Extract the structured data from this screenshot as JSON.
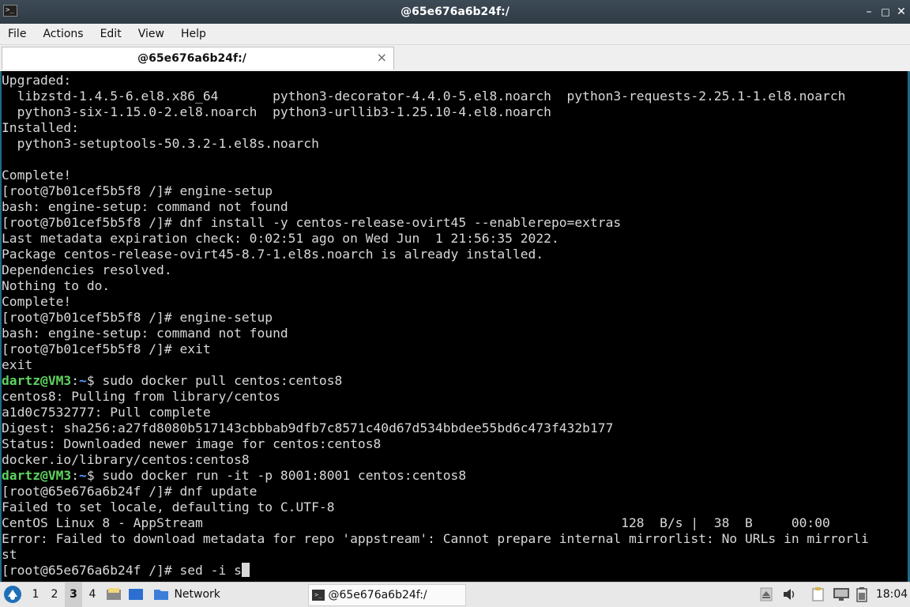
{
  "window": {
    "title": "@65e676a6b24f:/",
    "terminal_icon": ">_",
    "minimize_label": "–",
    "maximize_label": "□",
    "close_label": "✕"
  },
  "menu": [
    "File",
    "Actions",
    "Edit",
    "View",
    "Help"
  ],
  "tab": {
    "label": "@65e676a6b24f:/",
    "close": "×"
  },
  "terminal": {
    "lines": [
      "Upgraded:",
      "  libzstd-1.4.5-6.el8.x86_64       python3-decorator-4.4.0-5.el8.noarch  python3-requests-2.25.1-1.el8.noarch",
      "  python3-six-1.15.0-2.el8.noarch  python3-urllib3-1.25.10-4.el8.noarch",
      "Installed:",
      "  python3-setuptools-50.3.2-1.el8s.noarch",
      "",
      "Complete!",
      "[root@7b01cef5b5f8 /]# engine-setup",
      "bash: engine-setup: command not found",
      "[root@7b01cef5b5f8 /]# dnf install -y centos-release-ovirt45 --enablerepo=extras",
      "Last metadata expiration check: 0:02:51 ago on Wed Jun  1 21:56:35 2022.",
      "Package centos-release-ovirt45-8.7-1.el8s.noarch is already installed.",
      "Dependencies resolved.",
      "Nothing to do.",
      "Complete!",
      "[root@7b01cef5b5f8 /]# engine-setup",
      "bash: engine-setup: command not found",
      "[root@7b01cef5b5f8 /]# exit",
      "exit",
      {
        "user": "dartz@VM3",
        "sep": ":",
        "path": "~",
        "rest": "$ sudo docker pull centos:centos8"
      },
      "centos8: Pulling from library/centos",
      "a1d0c7532777: Pull complete",
      "Digest: sha256:a27fd8080b517143cbbbab9dfb7c8571c40d67d534bbdee55bd6c473f432b177",
      "Status: Downloaded newer image for centos:centos8",
      "docker.io/library/centos:centos8",
      {
        "user": "dartz@VM3",
        "sep": ":",
        "path": "~",
        "rest": "$ sudo docker run -it -p 8001:8001 centos:centos8"
      },
      "[root@65e676a6b24f /]# dnf update",
      "Failed to set locale, defaulting to C.UTF-8",
      "CentOS Linux 8 - AppStream                                                      128  B/s |  38  B     00:00",
      "Error: Failed to download metadata for repo 'appstream': Cannot prepare internal mirrorlist: No URLs in mirrorli",
      "st",
      {
        "text": "[root@65e676a6b24f /]# sed -i s",
        "cursor": true
      }
    ]
  },
  "taskbar": {
    "workspaces": [
      "1",
      "2",
      "3",
      "4"
    ],
    "active_workspace": "3",
    "folder_label": "Network",
    "task_label": "@65e676a6b24f:/",
    "clock": "18:04",
    "icons": [
      "start-menu-icon",
      "file-manager-icon",
      "desktop-icon",
      "folder-icon",
      "terminal-icon",
      "eject-icon",
      "volume-icon",
      "clipboard-icon",
      "network-icon",
      "battery-icon"
    ]
  }
}
